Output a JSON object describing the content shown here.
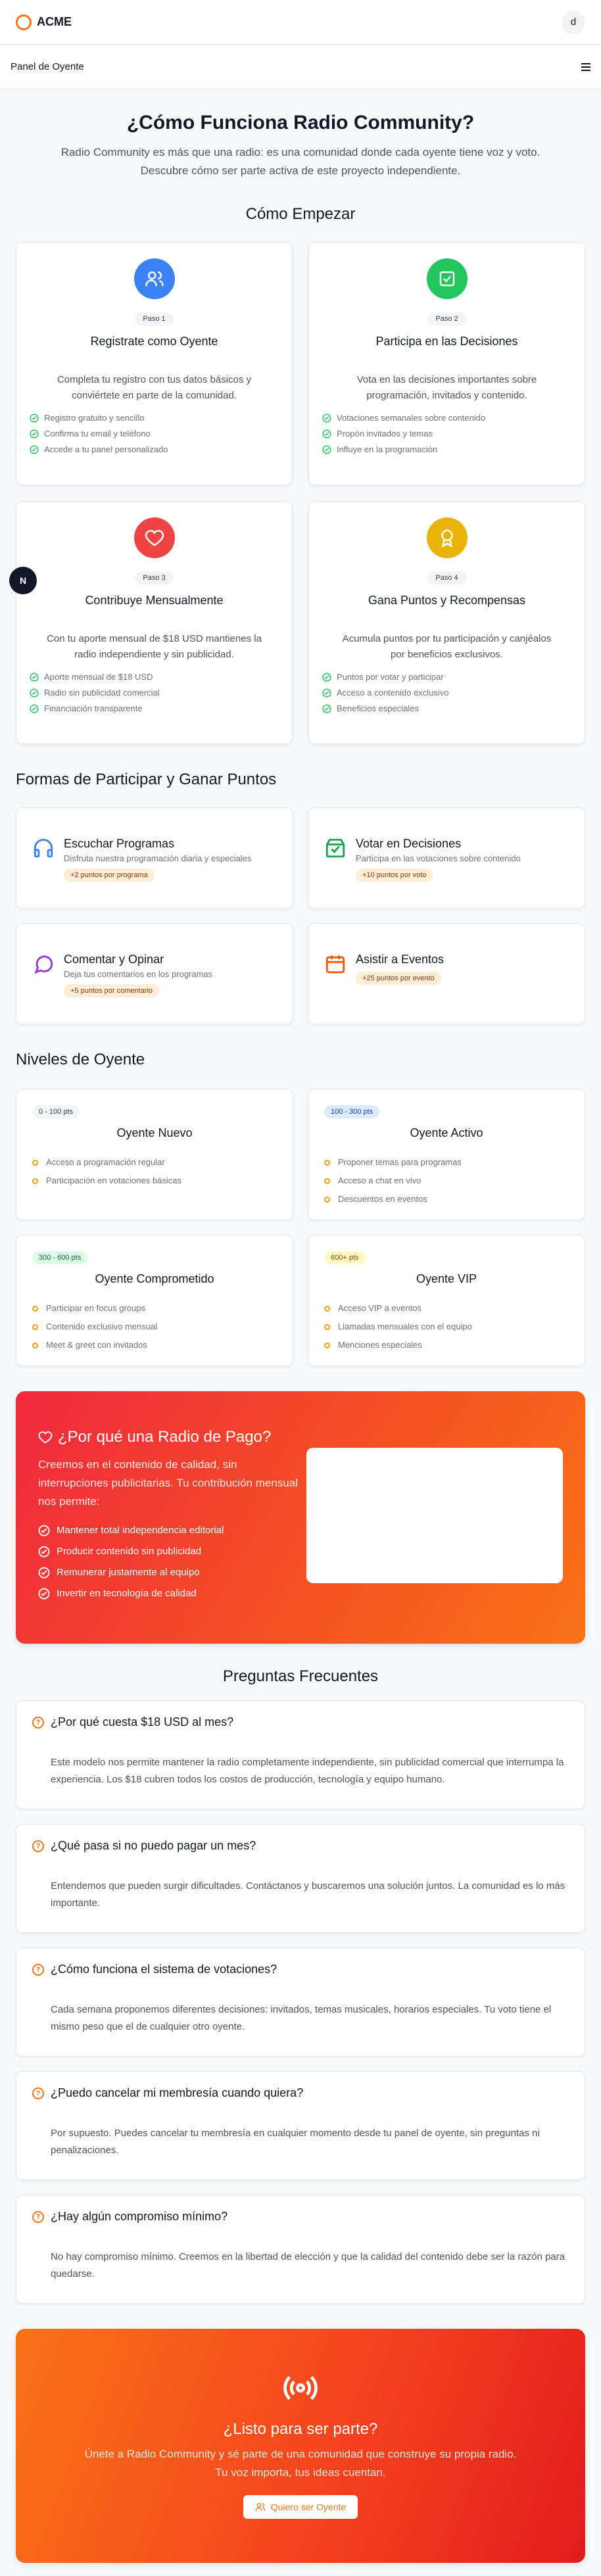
{
  "brand": {
    "name": "ACME",
    "avatar": "d"
  },
  "subbar": {
    "label": "Panel de Oyente",
    "fab": "N"
  },
  "hero": {
    "title": "¿Cómo Funciona Radio Community?",
    "lead": "Radio Community es más que una radio: es una comunidad donde cada oyente tiene voz y voto. Descubre cómo ser parte activa de este proyecto independiente."
  },
  "steps_title": "Cómo Empezar",
  "steps": [
    {
      "badge": "Paso 1",
      "title": "Registrate como Oyente",
      "desc": "Completa tu registro con tus datos básicos y conviértete en parte de la comunidad.",
      "items": [
        "Registro gratuito y sencillo",
        "Confirma tu email y teléfono",
        "Accede a tu panel personalizado"
      ],
      "color": "#3b82f6",
      "icon": "users-icon"
    },
    {
      "badge": "Paso 2",
      "title": "Participa en las Decisiones",
      "desc": "Vota en las decisiones importantes sobre programación, invitados y contenido.",
      "items": [
        "Votaciones semanales sobre contenido",
        "Propón invitados y temas",
        "Influye en la programación"
      ],
      "color": "#22c55e",
      "icon": "vote-icon"
    },
    {
      "badge": "Paso 3",
      "title": "Contribuye Mensualmente",
      "desc": "Con tu aporte mensual de $18 USD mantienes la radio independiente y sin publicidad.",
      "items": [
        "Aporte mensual de $18 USD",
        "Radio sin publicidad comercial",
        "Financiación transparente"
      ],
      "color": "#ef4444",
      "icon": "heart-icon"
    },
    {
      "badge": "Paso 4",
      "title": "Gana Puntos y Recompensas",
      "desc": "Acumula puntos por tu participación y canjéalos por beneficios exclusivos.",
      "items": [
        "Puntos por votar y participar",
        "Acceso a contenido exclusivo",
        "Beneficios especiales"
      ],
      "color": "#eab308",
      "icon": "award-icon"
    }
  ],
  "ways_title": "Formas de Participar y Ganar Puntos",
  "ways": [
    {
      "title": "Escuchar Programas",
      "desc": "Disfruta nuestra programación diaria y especiales",
      "points": "+2 puntos por programa",
      "color": "#3b82f6",
      "icon": "headphones-icon"
    },
    {
      "title": "Votar en Decisiones",
      "desc": "Participa en las votaciones sobre contenido",
      "points": "+10 puntos por voto",
      "color": "#16a34a",
      "icon": "vote-box-icon"
    },
    {
      "title": "Comentar y Opinar",
      "desc": "Deja tus comentarios en los programas",
      "points": "+5 puntos por comentario",
      "color": "#9333ea",
      "icon": "chat-icon"
    },
    {
      "title": "Asistir a Eventos",
      "desc": "",
      "points": "+25 puntos por evento",
      "color": "#ea580c",
      "icon": "calendar-icon"
    }
  ],
  "levels_title": "Niveles de Oyente",
  "levels": [
    {
      "range": "0 - 100 pts",
      "name": "Oyente Nuevo",
      "items": [
        "Acceso a programación regular",
        "Participación en votaciones básicas"
      ],
      "bg": "#f3f4f6",
      "fg": "#374151"
    },
    {
      "range": "100 - 300 pts",
      "name": "Oyente Activo",
      "items": [
        "Proponer temas para programas",
        "Acceso a chat en vivo",
        "Descuentos en eventos"
      ],
      "bg": "#dbeafe",
      "fg": "#1e40af"
    },
    {
      "range": "300 - 600 pts",
      "name": "Oyente Comprometido",
      "items": [
        "Participar en focus groups",
        "Contenido exclusivo mensual",
        "Meet & greet con invitados"
      ],
      "bg": "#dcfce7",
      "fg": "#166534"
    },
    {
      "range": "600+ pts",
      "name": "Oyente VIP",
      "items": [
        "Acceso VIP a eventos",
        "Llamadas mensuales con el equipo",
        "Menciones especiales"
      ],
      "bg": "#fef9c3",
      "fg": "#854d0e"
    }
  ],
  "paid": {
    "title": "¿Por qué una Radio de Pago?",
    "desc": "Creemos en el contenido de calidad, sin interrupciones publicitarias. Tu contribución mensual nos permite:",
    "items": [
      "Mantener total independencia editorial",
      "Producir contenido sin publicidad",
      "Remunerar justamente al equipo",
      "Invertir en tecnología de calidad"
    ]
  },
  "faq_title": "Preguntas Frecuentes",
  "faqs": [
    {
      "q": "¿Por qué cuesta $18 USD al mes?",
      "a": "Este modelo nos permite mantener la radio completamente independiente, sin publicidad comercial que interrumpa la experiencia. Los $18 cubren todos los costos de producción, tecnología y equipo humano."
    },
    {
      "q": "¿Qué pasa si no puedo pagar un mes?",
      "a": "Entendemos que pueden surgir dificultades. Contáctanos y buscaremos una solución juntos. La comunidad es lo más importante."
    },
    {
      "q": "¿Cómo funciona el sistema de votaciones?",
      "a": "Cada semana proponemos diferentes decisiones: invitados, temas musicales, horarios especiales. Tu voto tiene el mismo peso que el de cualquier otro oyente."
    },
    {
      "q": "¿Puedo cancelar mi membresía cuando quiera?",
      "a": "Por supuesto. Puedes cancelar tu membresía en cualquier momento desde tu panel de oyente, sin preguntas ni penalizaciones."
    },
    {
      "q": "¿Hay algún compromiso mínimo?",
      "a": "No hay compromiso mínimo. Creemos en la libertad de elección y que la calidad del contenido debe ser la razón para quedarse."
    }
  ],
  "cta": {
    "title": "¿Listo para ser parte?",
    "desc": "Únete a Radio Community y sé parte de una comunidad que construye su propia radio. Tu voz importa, tus ideas cuentan.",
    "button": "Quiero ser Oyente"
  }
}
